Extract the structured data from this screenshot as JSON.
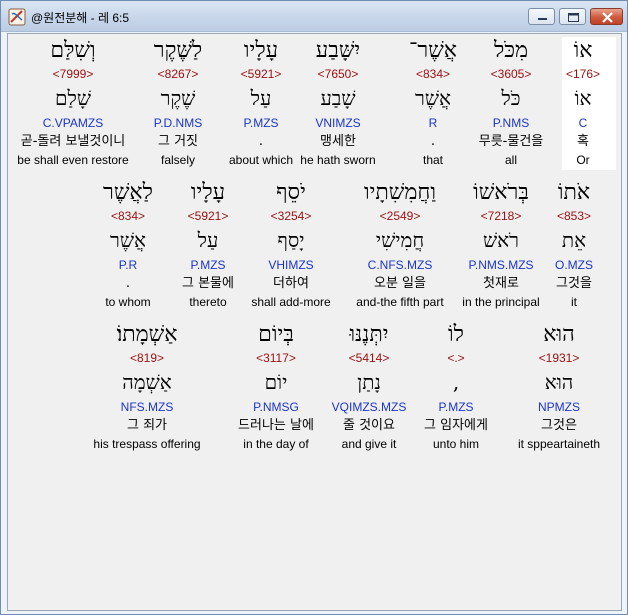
{
  "window": {
    "title": "@원전분해 - 레 6:5",
    "minimize_icon": "minimize-icon",
    "maximize_icon": "maximize-icon",
    "close_icon": "close-icon"
  },
  "colors": {
    "strong": "#9a1010",
    "morph": "#1a35c9",
    "text": "#000000",
    "highlight": "#ffffff"
  },
  "rows": [
    {
      "words": [
        {
          "hebrew": "אוֹ",
          "strong": "<176>",
          "lemma": "אוֹ",
          "morph": "C",
          "korean": "혹",
          "english": "Or"
        },
        {
          "hebrew": "מִכֹּל",
          "strong": "<3605>",
          "lemma": "כֹּל",
          "morph": "P.NMS",
          "korean": "무릇-물건을",
          "english": "all"
        },
        {
          "hebrew": "אֲשֶׁר־",
          "strong": "<834>",
          "lemma": "אֲשֶׁר",
          "morph": "R",
          "korean": ".",
          "english": "that"
        },
        {
          "hebrew": "יִשָּׁבַע",
          "strong": "<7650>",
          "lemma": "שָׁבַע",
          "morph": "VNIMZS",
          "korean": "맹세한",
          "english": "he hath sworn"
        },
        {
          "hebrew": "עָלָיו",
          "strong": "<5921>",
          "lemma": "עַל",
          "morph": "P.MZS",
          "korean": ".",
          "english": "about which"
        },
        {
          "hebrew": "לַשֶּׁקֶר",
          "strong": "<8267>",
          "lemma": "שֶׁקֶר",
          "morph": "P.D.NMS",
          "korean": "그 거짓",
          "english": "falsely"
        },
        {
          "hebrew": "וְשִׁלַּם",
          "strong": "<7999>",
          "lemma": "שָׁלַם",
          "morph": "C.VPAMZS",
          "korean": "곧-돌려 보낼것이니",
          "english": "be shall even restore"
        }
      ]
    },
    {
      "words": [
        {
          "hebrew": "אֹתוֹ",
          "strong": "<853>",
          "lemma": "אֵת",
          "morph": "O.MZS",
          "korean": "그것을",
          "english": "it"
        },
        {
          "hebrew": "בְּרֹאשׁוֹ",
          "strong": "<7218>",
          "lemma": "רֹאשׁ",
          "morph": "P.NMS.MZS",
          "korean": "첫재로",
          "english": "in the principal"
        },
        {
          "hebrew": "וַחֲמִשִׁתָיו",
          "strong": "<2549>",
          "lemma": "חֲמִישִׁי",
          "morph": "C.NFS.MZS",
          "korean": "오분 일을",
          "english": "and-the fifth part"
        },
        {
          "hebrew": "יֹסֵף",
          "strong": "<3254>",
          "lemma": "יָסַף",
          "morph": "VHIMZS",
          "korean": "더하여",
          "english": "shall add-more"
        },
        {
          "hebrew": "עָלָיו",
          "strong": "<5921>",
          "lemma": "עַל",
          "morph": "P.MZS",
          "korean": "그 본물에",
          "english": "thereto"
        },
        {
          "hebrew": "לַאֲשֶׁר",
          "strong": "<834>",
          "lemma": "אֲשֶׁר",
          "morph": "P.R",
          "korean": ".",
          "english": "to whom"
        }
      ]
    },
    {
      "words": [
        {
          "hebrew": "הוּא",
          "strong": "<1931>",
          "lemma": "הוּא",
          "morph": "NPMZS",
          "korean": "그것은",
          "english": "it sppeartaineth"
        },
        {
          "hebrew": "לוֹ",
          "strong": "<.>",
          "lemma": ",",
          "morph": "P.MZS",
          "korean": "그 임자에게",
          "english": "unto him"
        },
        {
          "hebrew": "יִתְּנֶנּוּ",
          "strong": "<5414>",
          "lemma": "נָתַן",
          "morph": "VQIMZS.MZS",
          "korean": "줄 것이요",
          "english": "and give it"
        },
        {
          "hebrew": "בְּיוֹם",
          "strong": "<3117>",
          "lemma": "יוֹם",
          "morph": "P.NMSG",
          "korean": "드러나는 날에",
          "english": "in the day of"
        },
        {
          "hebrew": "אַשְׁמָתוֹ׃",
          "strong": "<819>",
          "lemma": "אַשְׁמָה",
          "morph": "NFS.MZS",
          "korean": "그 죄가",
          "english": "his trespass offering"
        }
      ]
    }
  ]
}
